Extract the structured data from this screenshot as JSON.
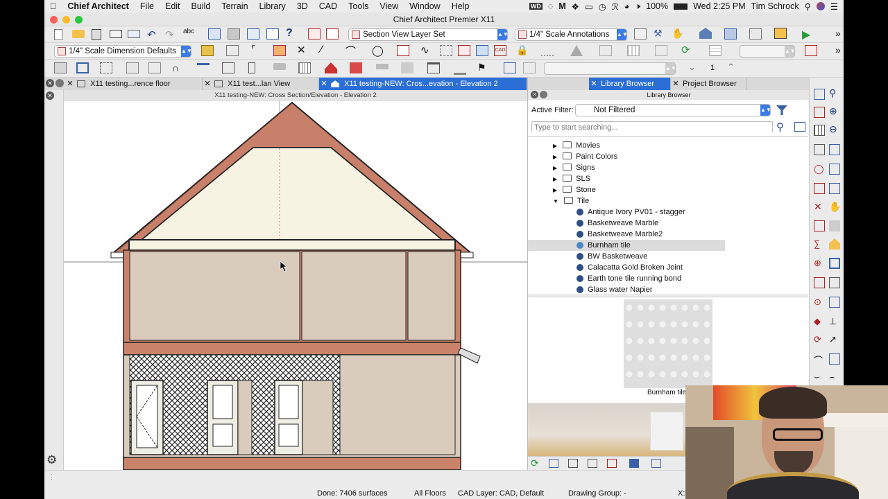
{
  "menubar": {
    "app_name": "Chief Architect",
    "items": [
      "File",
      "Edit",
      "Build",
      "Terrain",
      "Library",
      "3D",
      "CAD",
      "Tools",
      "View",
      "Window",
      "Help"
    ],
    "battery": "100%",
    "clock": "Wed 2:25 PM",
    "user": "Tim Schrock"
  },
  "window": {
    "title": "Chief Architect Premier X11"
  },
  "toolbar1": {
    "layer_set": "Section View Layer Set",
    "annotation_set": "1/4\" Scale Annotations"
  },
  "toolbar2": {
    "dimension_defaults": "1/4\" Scale Dimension Defaults"
  },
  "toolbar3": {
    "floor_value": "1"
  },
  "tabs": [
    {
      "label": "X11 testing...rence floor"
    },
    {
      "label": "X11 test...lan View"
    },
    {
      "label": "X11 testing-NEW: Cros...evation - Elevation 2"
    }
  ],
  "view": {
    "title": "X11 testing-NEW: Cross Section/Elevation - Elevation 2"
  },
  "library": {
    "tabs": [
      "Library Browser",
      "Project Browser"
    ],
    "header": "Library Browser",
    "filter_label": "Active Filter:",
    "filter_value": "Not Filtered",
    "search_placeholder": "Type to start searching...",
    "folders": [
      "Movies",
      "Paint Colors",
      "Signs",
      "SLS",
      "Stone",
      "Tile"
    ],
    "tile_items": [
      "Antique Ivory PV01 - stagger",
      "Basketweave Marble",
      "Basketweave Marble2",
      "Burnham tile",
      "BW Basketweave",
      "Calacatta Gold Broken Joint",
      "Earth tone tile running bond",
      "Glass water Napier"
    ],
    "selected_item": "Burnham tile",
    "preview_caption": "Burnham tile"
  },
  "status": {
    "done": "Done:  7406 surfaces",
    "floors": "All Floors",
    "cad_layer": "CAD Layer: CAD,  Default",
    "drawing_group": "Drawing Group: -",
    "coord_prefix": "X:"
  },
  "colors": {
    "accent": "#2b6ed6",
    "roof_fascia": "#c9806a",
    "gable": "#f7f3e3",
    "wall": "#d9ccbd",
    "floor_band": "#c88a6e"
  }
}
